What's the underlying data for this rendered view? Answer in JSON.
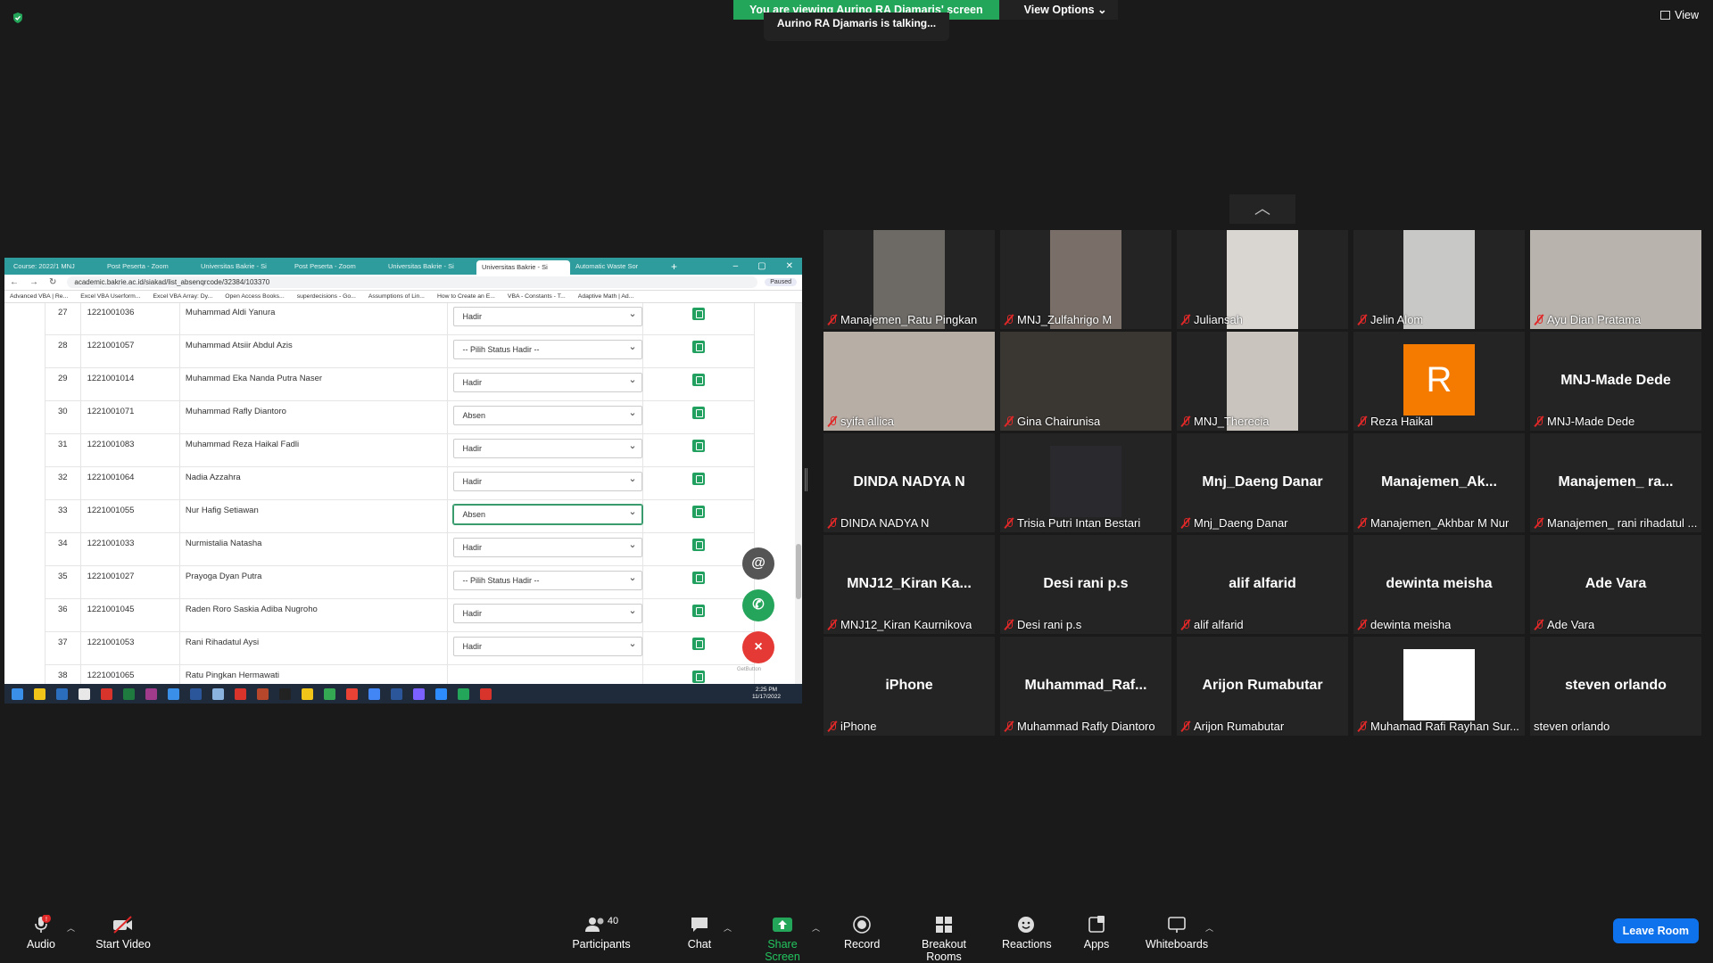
{
  "banner": {
    "viewing": "You are viewing Aurino RA Djamaris' screen",
    "view_options": "View Options",
    "talking": "Aurino RA Djamaris is talking...",
    "view": "View"
  },
  "browser": {
    "tabs": [
      "Course: 2022/1 MNJ",
      "Post Peserta - Zoom",
      "Universitas Bakrie - Si",
      "Post Peserta - Zoom",
      "Universitas Bakrie - Si",
      "Universitas Bakrie - Si",
      "Automatic Waste Sor"
    ],
    "url": "academic.bakrie.ac.id/siakad/list_absenqrcode/32384/103370",
    "paused": "Paused",
    "bookmarks": [
      "Advanced VBA | Re...",
      "Excel VBA Userform...",
      "Excel VBA Array: Dy...",
      "Open Access Books...",
      "superdecisions - Go...",
      "Assumptions of Lin...",
      "How to Create an E...",
      "VBA - Constants - T...",
      "Adaptive Math | Ad..."
    ],
    "rows": [
      {
        "no": "27",
        "nim": "1221001036",
        "name": "Muhammad Aldi Yanura",
        "status": "Hadir"
      },
      {
        "no": "28",
        "nim": "1221001057",
        "name": "Muhammad Atsiir Abdul Azis",
        "status": "-- Pilih Status Hadir --"
      },
      {
        "no": "29",
        "nim": "1221001014",
        "name": "Muhammad Eka Nanda Putra Naser",
        "status": "Hadir"
      },
      {
        "no": "30",
        "nim": "1221001071",
        "name": "Muhammad Rafly Diantoro",
        "status": "Absen"
      },
      {
        "no": "31",
        "nim": "1221001083",
        "name": "Muhammad Reza Haikal Fadli",
        "status": "Hadir"
      },
      {
        "no": "32",
        "nim": "1221001064",
        "name": "Nadia Azzahra",
        "status": "Hadir"
      },
      {
        "no": "33",
        "nim": "1221001055",
        "name": "Nur Hafig Setiawan",
        "status": "Absen"
      },
      {
        "no": "34",
        "nim": "1221001033",
        "name": "Nurmistalia Natasha",
        "status": "Hadir"
      },
      {
        "no": "35",
        "nim": "1221001027",
        "name": "Prayoga Dyan Putra",
        "status": "-- Pilih Status Hadir --"
      },
      {
        "no": "36",
        "nim": "1221001045",
        "name": "Raden Roro Saskia Adiba Nugroho",
        "status": "Hadir"
      },
      {
        "no": "37",
        "nim": "1221001053",
        "name": "Rani Rihadatul Aysi",
        "status": "Hadir"
      },
      {
        "no": "38",
        "nim": "1221001065",
        "name": "Ratu Pingkan Hermawati",
        "status": ""
      }
    ],
    "getbutton": "GetButton",
    "clock_time": "2:25 PM",
    "clock_date": "11/17/2022"
  },
  "gallery": [
    {
      "big": "",
      "label": "Manajemen_Ratu Pingkan",
      "video": true,
      "muted": true
    },
    {
      "big": "",
      "label": "MNJ_Zulfahrigo M",
      "video": true,
      "muted": true
    },
    {
      "big": "",
      "label": "Juliansah",
      "video": true,
      "muted": true
    },
    {
      "big": "",
      "label": "Jelin Alom",
      "video": true,
      "muted": true
    },
    {
      "big": "",
      "label": "Ayu Dian Pratama",
      "video": true,
      "muted": true
    },
    {
      "big": "",
      "label": "syifa allica",
      "video": true,
      "muted": true
    },
    {
      "big": "",
      "label": "Gina Chairunisa",
      "video": true,
      "muted": true
    },
    {
      "big": "",
      "label": "MNJ_Therecia",
      "video": true,
      "muted": true
    },
    {
      "big": "R",
      "label": "Reza Haikal",
      "video": false,
      "muted": true
    },
    {
      "big": "MNJ-Made Dede",
      "label": "MNJ-Made Dede",
      "video": false,
      "muted": true
    },
    {
      "big": "DINDA NADYA N",
      "label": "DINDA NADYA N",
      "video": false,
      "muted": true
    },
    {
      "big": "",
      "label": "Trisia Putri Intan Bestari",
      "video": true,
      "muted": true
    },
    {
      "big": "Mnj_Daeng Danar",
      "label": "Mnj_Daeng Danar",
      "video": false,
      "muted": true
    },
    {
      "big": "Manajemen_Ak...",
      "label": "Manajemen_Akhbar M Nur",
      "video": false,
      "muted": true
    },
    {
      "big": "Manajemen_ ra...",
      "label": "Manajemen_ rani rihadatul ...",
      "video": false,
      "muted": true
    },
    {
      "big": "MNJ12_Kiran Ka...",
      "label": "MNJ12_Kiran Kaurnikova",
      "video": false,
      "muted": true
    },
    {
      "big": "Desi rani p.s",
      "label": "Desi rani p.s",
      "video": false,
      "muted": true
    },
    {
      "big": "alif alfarid",
      "label": "alif alfarid",
      "video": false,
      "muted": true
    },
    {
      "big": "dewinta meisha",
      "label": "dewinta meisha",
      "video": false,
      "muted": true
    },
    {
      "big": "Ade Vara",
      "label": "Ade Vara",
      "video": false,
      "muted": true
    },
    {
      "big": "iPhone",
      "label": "iPhone",
      "video": false,
      "muted": true
    },
    {
      "big": "Muhammad_Raf...",
      "label": "Muhammad Rafly Diantoro",
      "video": false,
      "muted": true
    },
    {
      "big": "Arijon Rumabutar",
      "label": "Arijon Rumabutar",
      "video": false,
      "muted": true
    },
    {
      "big": "",
      "label": "Muhamad Rafi Rayhan Sur...",
      "video": false,
      "muted": true
    },
    {
      "big": "steven orlando",
      "label": "steven orlando",
      "video": false,
      "muted": false
    }
  ],
  "toolbar": {
    "audio": "Audio",
    "audio_badge": "!",
    "start_video": "Start Video",
    "participants": "Participants",
    "participants_count": "40",
    "chat": "Chat",
    "share_screen": "Share Screen",
    "record": "Record",
    "breakout": "Breakout Rooms",
    "reactions": "Reactions",
    "apps": "Apps",
    "whiteboards": "Whiteboards",
    "leave": "Leave Room"
  }
}
